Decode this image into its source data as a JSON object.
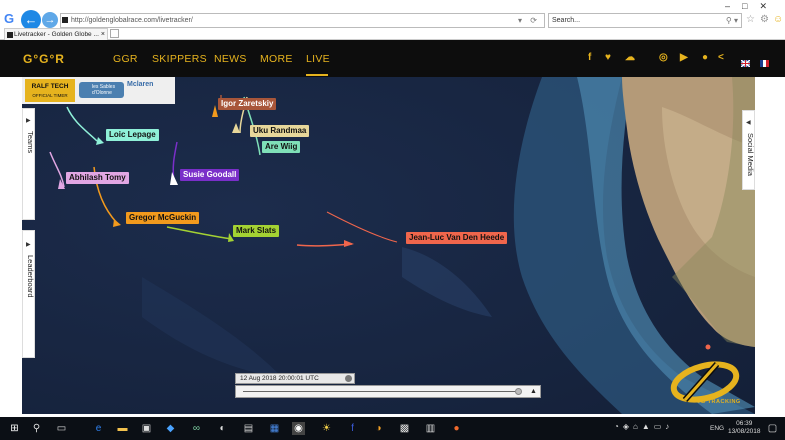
{
  "browser": {
    "url": "http://goldenglobalrace.com/livetracker/",
    "search_placeholder": "Search...",
    "tab_title": "Livetracker - Golden Globe ...",
    "tab_close": "×"
  },
  "site": {
    "logo": "G°G°R",
    "nav": [
      "GGR",
      "SKIPPERS",
      "NEWS",
      "MORE",
      "LIVE"
    ],
    "active_nav": "LIVE",
    "social_icons": [
      "facebook-icon",
      "twitter-icon",
      "soundcloud-icon",
      "instagram-icon",
      "youtube-icon",
      "podcast-icon",
      "share-icon"
    ],
    "languages": [
      "en-flag-icon",
      "fr-flag-icon"
    ]
  },
  "sponsors": {
    "ralf_name": "RALF TECH",
    "ralf_sub": "OFFICIAL TIMER",
    "sables_text": "les Sables d'Olonne",
    "mcl_text": "Mclaren"
  },
  "side_tabs": {
    "teams": "Teams",
    "leaderboard": "Leaderboard",
    "social": "Social Media"
  },
  "boats": [
    {
      "name": "Igor Zaretskiy",
      "color": "#a8563a"
    },
    {
      "name": "Uku Randmaa",
      "color": "#e7d79a"
    },
    {
      "name": "Are Wiig",
      "color": "#7fe0b8"
    },
    {
      "name": "Loic Lepage",
      "color": "#8ff0d8"
    },
    {
      "name": "Susie Goodall",
      "color": "#7a2fc9"
    },
    {
      "name": "Abhilash Tomy",
      "color": "#e1a6e3"
    },
    {
      "name": "Gregor McGuckin",
      "color": "#f29a1d"
    },
    {
      "name": "Mark Slats",
      "color": "#a4d233"
    },
    {
      "name": "Jean-Luc Van Den Heede",
      "color": "#f0664c"
    }
  ],
  "timeline": {
    "timestamp": "12 Aug 2018 20:00:01 UTC",
    "play_symbol": "▲"
  },
  "branding": {
    "yb_text": "YB TRACKING"
  },
  "taskbar": {
    "lang": "ENG",
    "time": "06:39",
    "date": "13/08/2018"
  }
}
